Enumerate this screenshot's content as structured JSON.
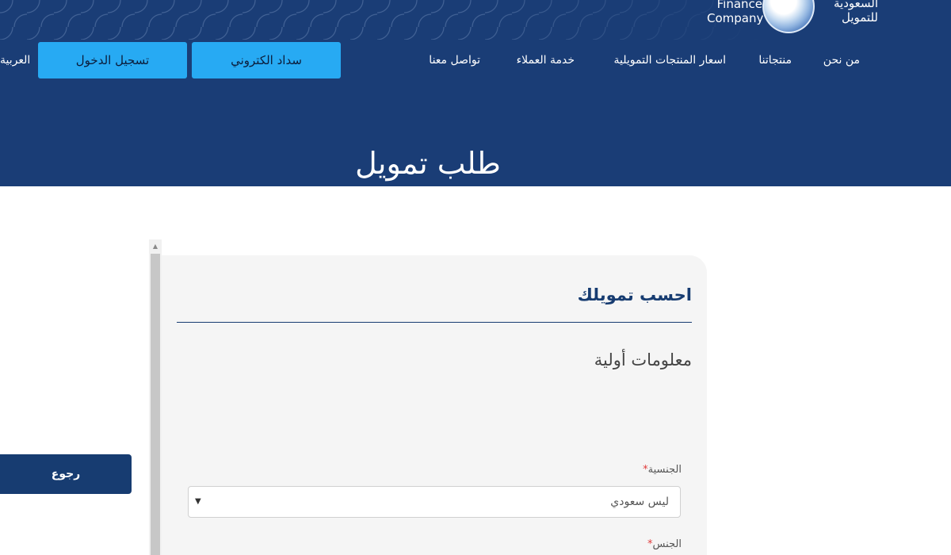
{
  "logo": {
    "name_en": "Finance\nCompany",
    "name_ar": "السعودية\nللتمويل"
  },
  "nav": {
    "links": [
      "من نحن",
      "منتجاتنا",
      "اسعار المنتجات التمويلية",
      "خدمة العملاء",
      "تواصل معنا"
    ],
    "pay_label": "سداد الكتروني",
    "login_label": "تسجيل الدخول",
    "language_label": "العربية"
  },
  "page": {
    "title": "طلب تمويل"
  },
  "back_button": "رجوع",
  "form": {
    "card_title": "احسب تمويلك",
    "section_title": "معلومات أولية",
    "fields": [
      {
        "label": "الجنسية",
        "required_mark": "*",
        "value": "ليس سعودي"
      },
      {
        "label": "الجنس",
        "required_mark": "*"
      }
    ]
  },
  "colors": {
    "header_bg": "#1a3d76",
    "button_accent": "#27aaf3",
    "back_button_bg": "#173c71",
    "required": "#e03a3a"
  },
  "icons": [
    "chevron-down-icon",
    "scroll-up-arrow-icon",
    "logo-emblem-icon"
  ]
}
